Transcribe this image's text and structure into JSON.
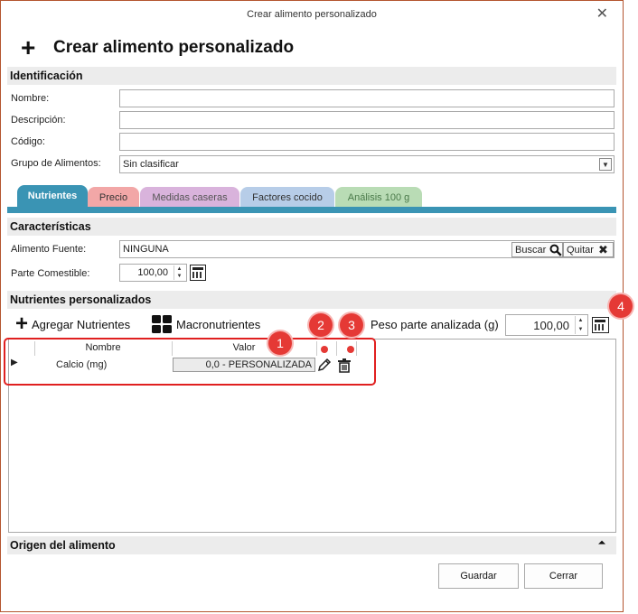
{
  "window": {
    "title": "Crear alimento personalizado",
    "close_glyph": "✕"
  },
  "header": {
    "icon": "plus-icon",
    "title": "Crear alimento personalizado"
  },
  "identificacion": {
    "section_title": "Identificación",
    "nombre_label": "Nombre:",
    "nombre_value": "",
    "descripcion_label": "Descripción:",
    "descripcion_value": "",
    "codigo_label": "Código:",
    "codigo_value": "",
    "grupo_label": "Grupo de Alimentos:",
    "grupo_value": "Sin clasificar"
  },
  "tabs": [
    {
      "label": "Nutrientes",
      "color": "#3a94b4",
      "text_color": "#ffffff",
      "active": true
    },
    {
      "label": "Precio",
      "color": "#f2a7a7",
      "text_color": "#333333",
      "active": false
    },
    {
      "label": "Medidas caseras",
      "color": "#d9b3dc",
      "text_color": "#555555",
      "active": false
    },
    {
      "label": "Factores cocido",
      "color": "#b7cde8",
      "text_color": "#333333",
      "active": false
    },
    {
      "label": "Análisis 100 g",
      "color": "#b9dcb5",
      "text_color": "#4a7a4a",
      "active": false
    }
  ],
  "caracteristicas": {
    "section_title": "Características",
    "fuente_label": "Alimento Fuente:",
    "fuente_value": "NINGUNA",
    "buscar_label": "Buscar",
    "quitar_label": "Quitar",
    "comestible_label": "Parte Comestible:",
    "comestible_value": "100,00"
  },
  "nutrientes": {
    "section_title": "Nutrientes personalizados",
    "agregar_label": "Agregar Nutrientes",
    "macro_label": "Macronutrientes",
    "peso_label": "Peso parte analizada (g)",
    "peso_value": "100,00",
    "columns": {
      "nombre": "Nombre",
      "valor": "Valor"
    },
    "rows": [
      {
        "nombre": "Calcio (mg)",
        "valor": "0,0 - PERSONALIZADA"
      }
    ]
  },
  "annotations": [
    "1",
    "2",
    "3",
    "4"
  ],
  "annotation_color": "#e53935",
  "origen": {
    "section_title": "Origen del alimento",
    "collapse_glyph": "⌃"
  },
  "footer": {
    "guardar_label": "Guardar",
    "cerrar_label": "Cerrar"
  }
}
